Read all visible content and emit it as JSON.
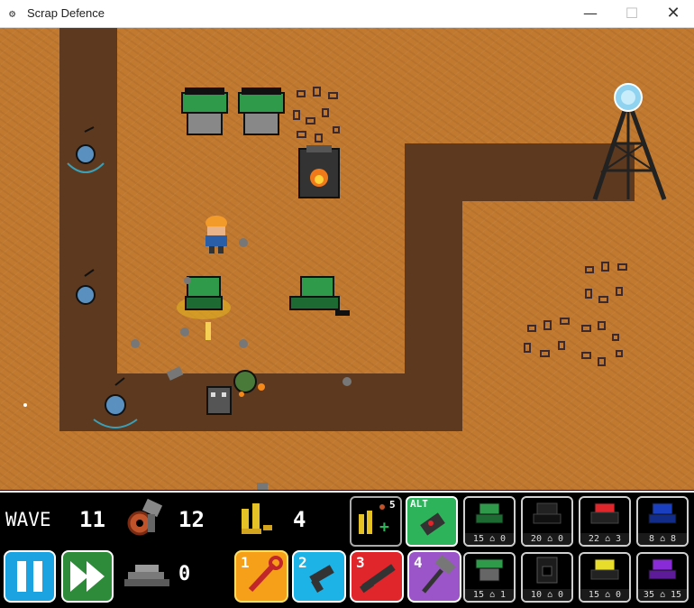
{
  "window": {
    "title": "Scrap Defence",
    "icon": "gear-icon",
    "controls": {
      "minimize": "—",
      "maximize": "☐",
      "close": "✕"
    }
  },
  "hud": {
    "wave_label": "WAVE",
    "wave_value": "11",
    "scrap_value": "12",
    "ammo_value": "4",
    "metal_value": "0",
    "ammo_refill_count": "5",
    "alt_label": "ALT",
    "weapons": [
      {
        "num": "1",
        "name": "wrench",
        "color": "#f6a019"
      },
      {
        "num": "2",
        "name": "pistol",
        "color": "#1eb3e6"
      },
      {
        "num": "3",
        "name": "shotgun",
        "color": "#e0252b"
      },
      {
        "num": "4",
        "name": "hammer",
        "color": "#9b55c8"
      }
    ],
    "build_slots_top": [
      {
        "name": "green-turret",
        "cost_a": "15",
        "cost_b": "0"
      },
      {
        "name": "black-turret",
        "cost_a": "20",
        "cost_b": "0"
      },
      {
        "name": "red-turret",
        "cost_a": "22",
        "cost_b": "3"
      },
      {
        "name": "blue-turret",
        "cost_a": "8",
        "cost_b": "8"
      }
    ],
    "build_slots_bottom": [
      {
        "name": "green-drill",
        "cost_a": "15",
        "cost_b": "1"
      },
      {
        "name": "black-furnace",
        "cost_a": "10",
        "cost_b": "0"
      },
      {
        "name": "yellow-turret",
        "cost_a": "15",
        "cost_b": "0"
      },
      {
        "name": "purple-turret",
        "cost_a": "35",
        "cost_b": "15"
      }
    ],
    "colors": {
      "pause": "#1aa3e0",
      "fast_forward": "#2e8b3a",
      "alt": "#2db35a"
    }
  }
}
